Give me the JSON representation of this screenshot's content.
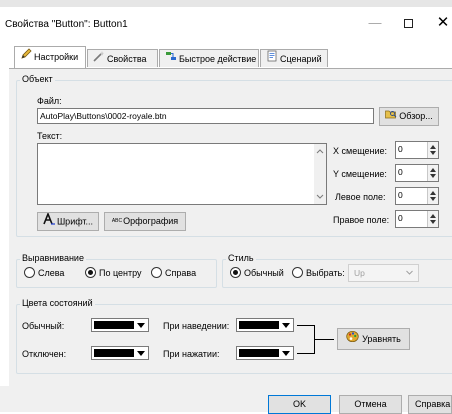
{
  "window": {
    "title": "Свойства \"Button\": Button1",
    "minimize_glyph": "—",
    "close_glyph": "✕"
  },
  "tabs": [
    {
      "label": "Настройки",
      "icon": "pencil-icon",
      "active": true
    },
    {
      "label": "Свойства",
      "icon": "wand-icon",
      "active": false
    },
    {
      "label": "Быстрое действие",
      "icon": "action-icon",
      "active": false
    },
    {
      "label": "Сценарий",
      "icon": "script-icon",
      "active": false
    }
  ],
  "object_group": {
    "legend": "Объект",
    "file_label": "Файл:",
    "file_value": "AutoPlay\\Buttons\\0002-royale.btn",
    "browse_label": "Обзор...",
    "text_label": "Текст:",
    "text_value": "",
    "font_button": "Шрифт...",
    "spelling_button": "Орфография",
    "spelling_badge": "ABC",
    "x_offset_label": "X смещение:",
    "x_offset_value": "0",
    "y_offset_label": "Y смещение:",
    "y_offset_value": "0",
    "left_margin_label": "Левое поле:",
    "left_margin_value": "0",
    "right_margin_label": "Правое поле:",
    "right_margin_value": "0"
  },
  "align_group": {
    "legend": "Выравнивание",
    "options": [
      "Слева",
      "По центру",
      "Справа"
    ],
    "selected": "По центру"
  },
  "style_group": {
    "legend": "Стиль",
    "options": [
      "Обычный",
      "Выбрать:"
    ],
    "selected": "Обычный",
    "select_value": "Up"
  },
  "colors_group": {
    "legend": "Цвета состояний",
    "normal_label": "Обычный:",
    "hover_label": "При наведении:",
    "disabled_label": "Отключен:",
    "pressed_label": "При нажатии:",
    "swatch_color": "#000000",
    "equalize_button": "Уравнять"
  },
  "footer": {
    "ok": "OK",
    "cancel": "Отмена",
    "help": "Справка"
  }
}
